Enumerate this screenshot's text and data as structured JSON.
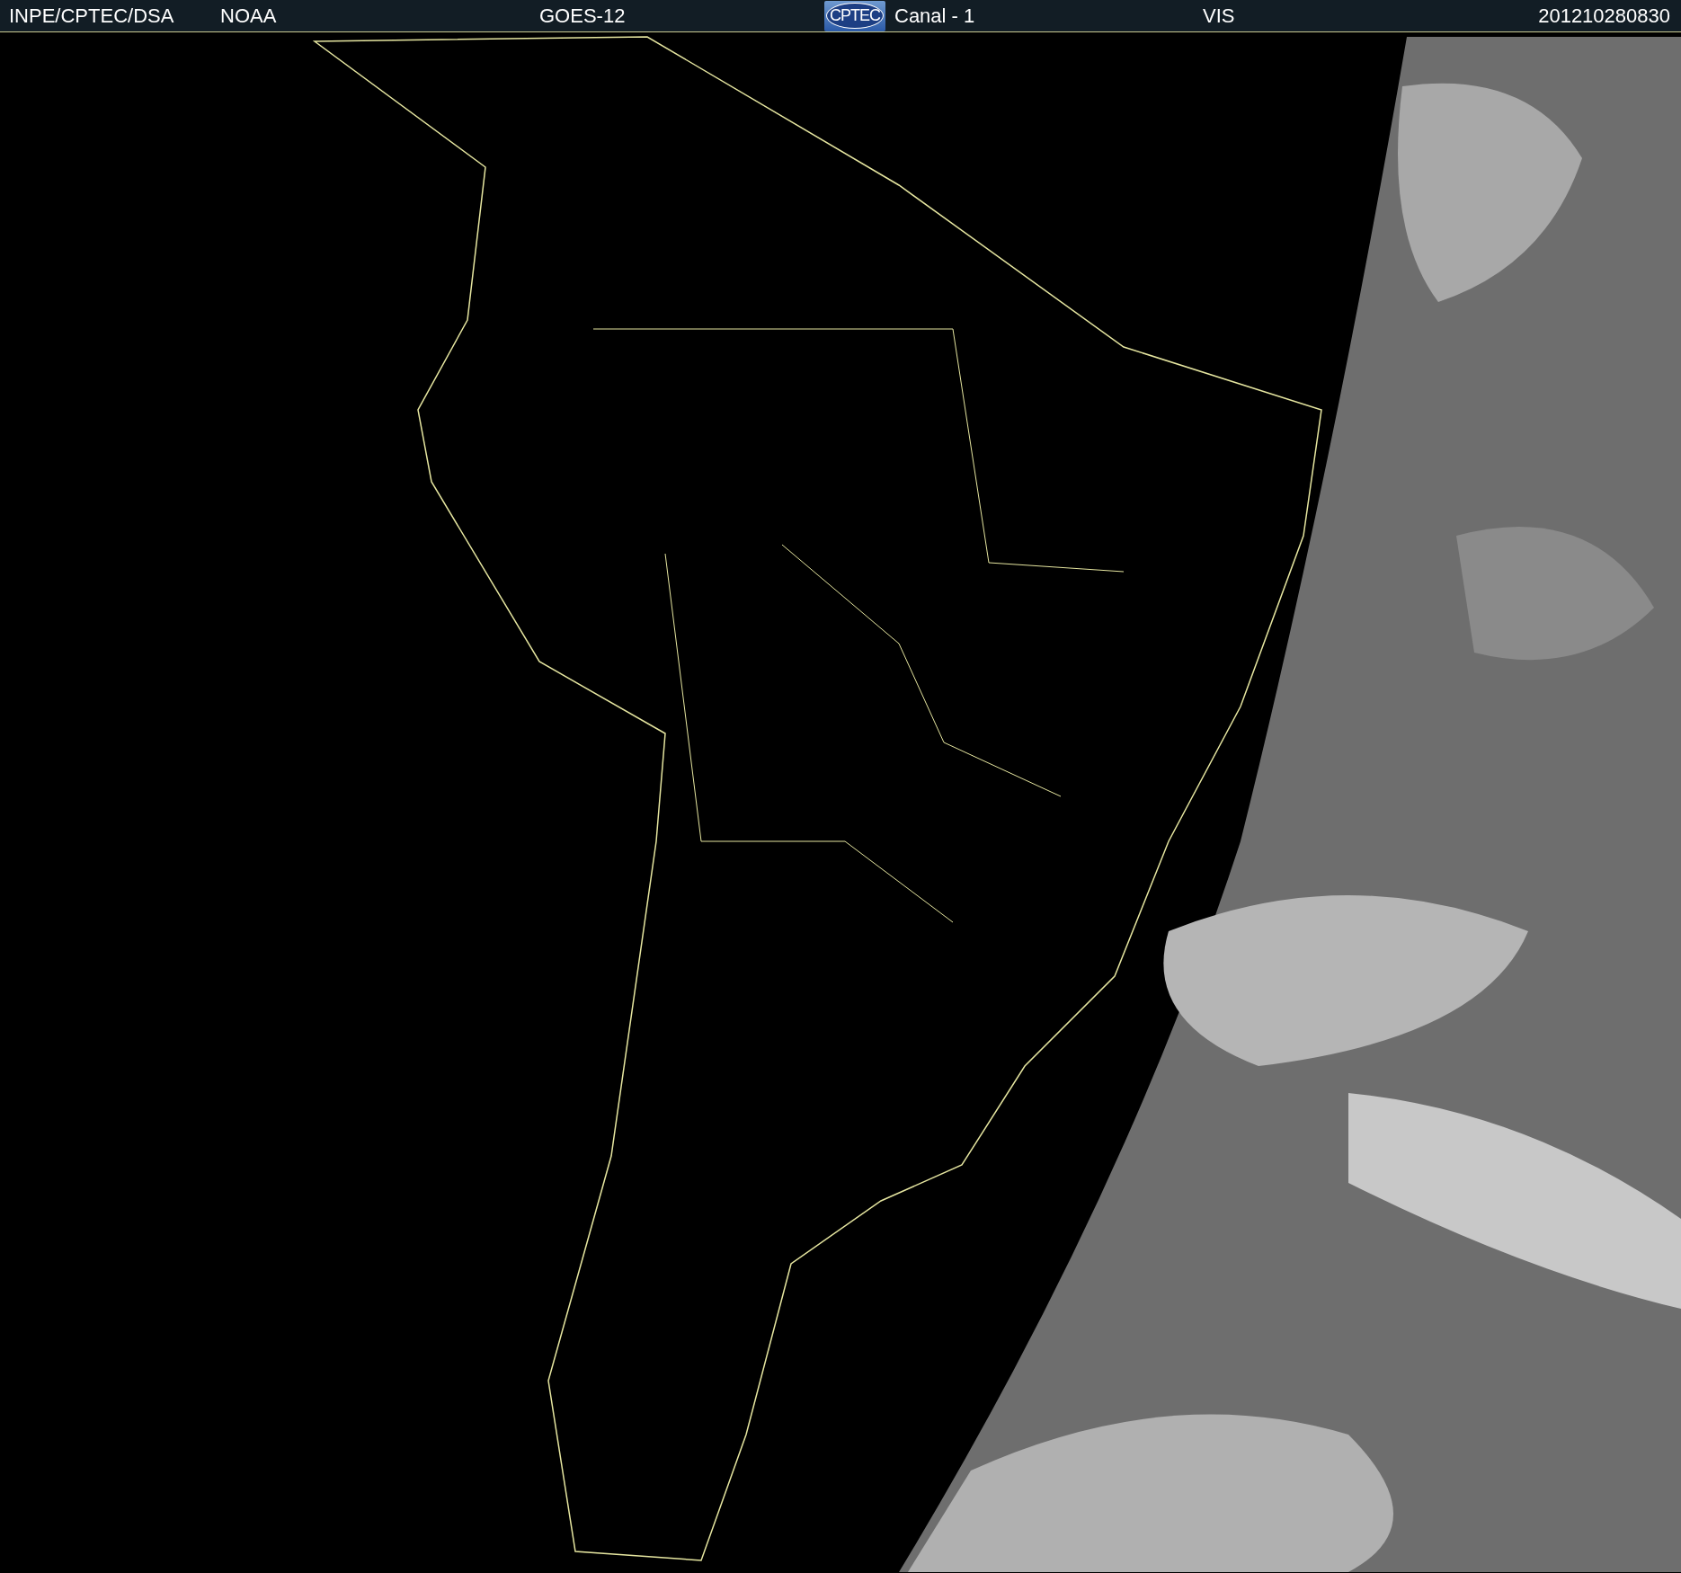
{
  "header": {
    "items": [
      {
        "kind": "text",
        "text": "INPE/CPTEC/DSA"
      },
      {
        "kind": "text",
        "text": "NOAA"
      },
      {
        "kind": "text",
        "text": "GOES-12"
      },
      {
        "kind": "logo",
        "text": "CPTEC"
      },
      {
        "kind": "text",
        "text": "Canal - 1"
      },
      {
        "kind": "text",
        "text": "VIS"
      },
      {
        "kind": "text",
        "text": "201210280830"
      }
    ]
  }
}
